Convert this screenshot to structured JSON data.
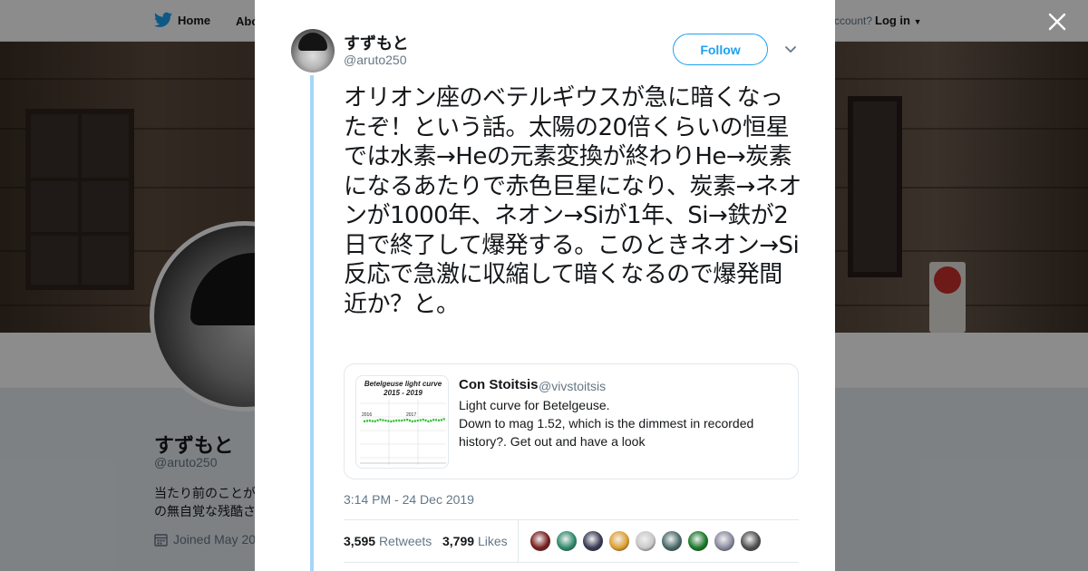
{
  "nav": {
    "home": "Home",
    "about": "Abo",
    "account_prompt": "ccount?",
    "login": "Log in"
  },
  "profile": {
    "name": "すずもと",
    "handle": "@aruto250",
    "bio_lines": [
      "当たり前のことが",
      "の無自覚な残酷さ"
    ],
    "joined": "Joined May 20"
  },
  "tweet": {
    "author_name": "すずもと",
    "author_handle": "@aruto250",
    "follow_label": "Follow",
    "text": "オリオン座のベテルギウスが急に暗くなったぞ！という話。太陽の20倍くらいの恒星では水素→Heの元素変換が終わりHe→炭素になるあたりで赤色巨星になり、炭素→ネオンが1000年、ネオン→Siが1年、Si→鉄が2日で終了して爆発する。このときネオン→Si反応で急激に収縮して暗くなるので爆発間近か？と。",
    "timestamp": "3:14 PM - 24 Dec 2019",
    "retweets_count": "3,595",
    "retweets_label": "Retweets",
    "likes_count": "3,799",
    "likes_label": "Likes"
  },
  "quote": {
    "name": "Con Stoitsis",
    "handle": "@vivstoitsis",
    "line1": "Light curve for Betelgeuse.",
    "line2": "Down to mag 1.52, which is the dimmest in recorded history?. Get out and have a look",
    "thumb_title": "Betelgeuse light curve 2015 - 2019",
    "thumb_year_a": "2016",
    "thumb_year_b": "2017"
  },
  "liker_colors": [
    "#7a1f1f",
    "#2e8b6a",
    "#3a3a55",
    "#e0a030",
    "#c8c8c8",
    "#4a6a6a",
    "#1a7a2a",
    "#8a8aa0",
    "#505050"
  ],
  "colors": {
    "twitter_blue": "#1da1f2",
    "thread_line": "#a7d6f7"
  }
}
